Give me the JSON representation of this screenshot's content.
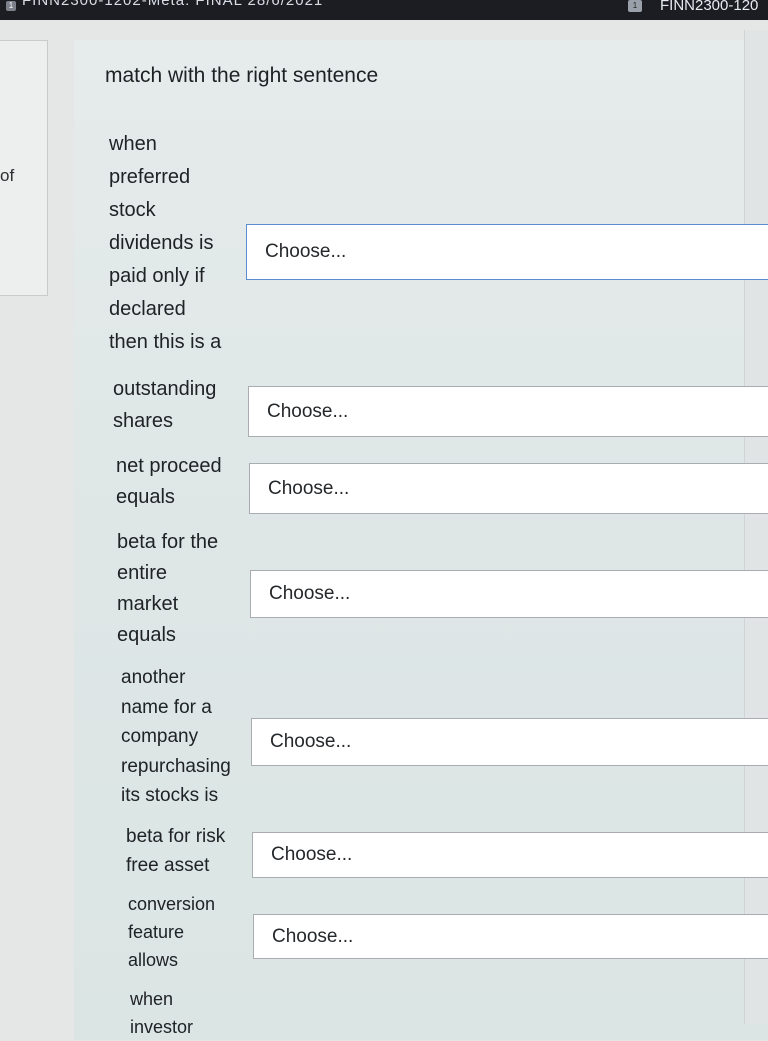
{
  "window": {
    "title_left": "FINN2300-1202-Meta: FINAL 28/6/2021",
    "title_right": "FINN2300-120"
  },
  "left_panel": {
    "text": "of"
  },
  "question": {
    "instruction": "match with the right sentence",
    "items": [
      {
        "prompt": "when\npreferred\nstock\ndividends is\npaid only if\ndeclared\nthen this is a",
        "selected": "Choose..."
      },
      {
        "prompt": "outstanding\nshares",
        "selected": "Choose..."
      },
      {
        "prompt": "net proceed\nequals",
        "selected": "Choose..."
      },
      {
        "prompt": "beta for the\nentire\nmarket\nequals",
        "selected": "Choose..."
      },
      {
        "prompt": "another\nname for  a\ncompany\nrepurchasing\nits stocks is",
        "selected": "Choose..."
      },
      {
        "prompt": "beta for risk\nfree asset",
        "selected": "Choose..."
      },
      {
        "prompt": "conversion\nfeature\nallows",
        "selected": "Choose..."
      },
      {
        "prompt": "when\ninvestor",
        "selected": ""
      }
    ]
  }
}
